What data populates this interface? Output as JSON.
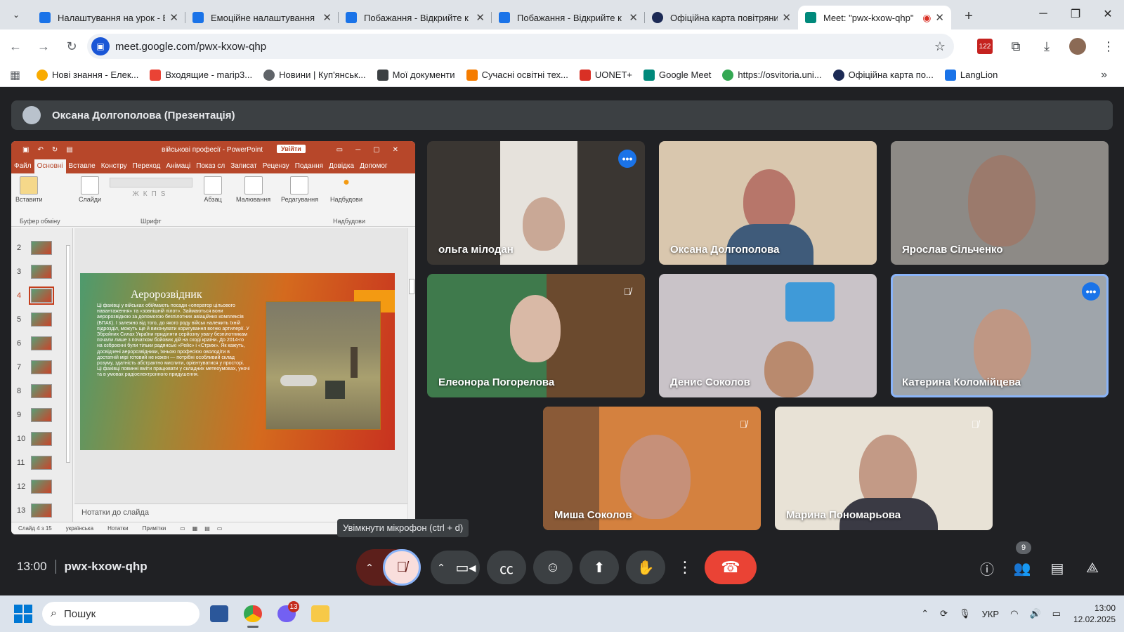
{
  "browser": {
    "tabs": [
      {
        "title": "Налаштування на урок - В",
        "color": "#1a73e8"
      },
      {
        "title": "Емоційне налаштування",
        "color": "#1a73e8"
      },
      {
        "title": "Побажання - Відкрийте к",
        "color": "#1a73e8"
      },
      {
        "title": "Побажання - Відкрийте к",
        "color": "#1a73e8"
      },
      {
        "title": "Офіційна карта повітряни",
        "color": "#1c2a55"
      },
      {
        "title": "Meet: \"pwx-kxow-qhp\"",
        "color": "#00897b",
        "active": true
      }
    ],
    "url": "meet.google.com/pwx-kxow-qhp",
    "calendar_badge": "122",
    "bookmarks": [
      {
        "label": "Нові знання - Елек...",
        "color": "#f9ab00"
      },
      {
        "label": "Входящие - marip3...",
        "color": "#ea4335"
      },
      {
        "label": "Новини | Куп'янськ...",
        "color": "#5f6368"
      },
      {
        "label": "Мої документи",
        "color": "#3c4043"
      },
      {
        "label": "Сучасні освітні тех...",
        "color": "#f57c00"
      },
      {
        "label": "UONET+",
        "color": "#d93025"
      },
      {
        "label": "Google Meet",
        "color": "#00897b"
      },
      {
        "label": "https://osvitoria.uni...",
        "color": "#34a853"
      },
      {
        "label": "Офіційна карта по...",
        "color": "#1c2a55"
      },
      {
        "label": "LangLion",
        "color": "#1a73e8"
      }
    ]
  },
  "meet": {
    "presenter": "Оксана Долгополова (Презентація)",
    "tooltip": "Увімкнути мікрофон (ctrl + d)",
    "time": "13:00",
    "code": "pwx-kxow-qhp",
    "participant_count": "9",
    "participants": [
      {
        "name": "ольга мілодан",
        "badge": "talking"
      },
      {
        "name": "Оксана Долгополова"
      },
      {
        "name": "Ярослав Сільченко"
      },
      {
        "name": "Елеонора Погорелова",
        "muted": true
      },
      {
        "name": "Денис Соколов"
      },
      {
        "name": "Катерина Коломійцева",
        "badge": "more"
      },
      {
        "name": "Миша Соколов",
        "muted": true
      },
      {
        "name": "Марина Пономарьова",
        "muted": true
      }
    ]
  },
  "powerpoint": {
    "doc_title": "військові професії - PowerPoint",
    "signin": "Увійти",
    "tabs": [
      "Файл",
      "Основні",
      "Вставле",
      "Констру",
      "Переход",
      "Анімаці",
      "Показ сл",
      "Записат",
      "Рецензу",
      "Подання",
      "Довідка",
      "Допомог"
    ],
    "ribbon_groups": [
      "Вставити",
      "Слайди",
      "Абзац",
      "Малювання",
      "Редагування",
      "Надбудови"
    ],
    "ribbon_labels": [
      "Буфер обміну",
      "Шрифт",
      "Надбудови"
    ],
    "slide_numbers": [
      "2",
      "3",
      "4",
      "5",
      "6",
      "7",
      "8",
      "9",
      "10",
      "11",
      "12",
      "13"
    ],
    "slide_title": "Аеророзвідник",
    "slide_body": "Ці фахівці у військах обіймають посади «оператор цільового навантаження» та «зовнішній пілот». Займаються вони аеророзвідкою за допомогою безпілотних авіаційних комплексів (БПАК). І залежно від того, до якого роду військ належить їхній підрозділ, можуть ще й виконувати коригування вогню артилерії. У Збройних Силах України приділяти серйозну увагу безпілотникам почали лише з початком бойових дій на сході країни. До 2014-го на озброєнні були тільки радянські «Рейс» і «Стриж». Як кажуть, досвідчені аеророзвідники, їхньою професією оволодіти в достатній мірі готовий не кожен — потрібні особливий склад розуму, здатність абстрактно мислити, орієнтуватися у просторі. Ці фахівці повинні вміти працювати у складних метеоумовах, уночі та в умовах радіоелектронного придушення.",
    "notes": "Нотатки до слайда",
    "status": [
      "Слайд 4 з 15",
      "українська",
      "Нотатки",
      "Примітки"
    ]
  },
  "taskbar": {
    "search": "Пошук",
    "viber_badge": "13",
    "lang": "УКР",
    "time": "13:00",
    "date": "12.02.2025"
  }
}
